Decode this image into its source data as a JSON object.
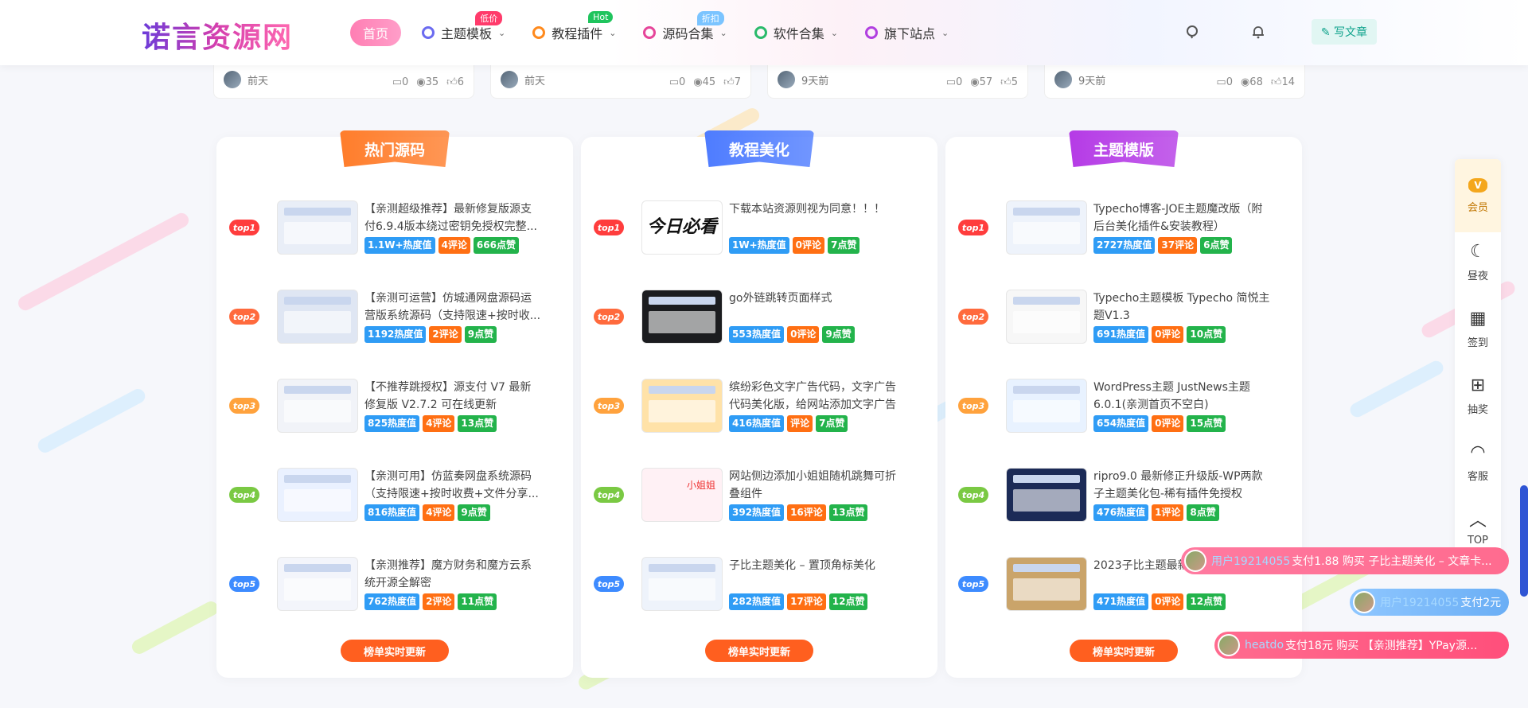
{
  "header": {
    "logo": "诺言资源网",
    "nav": [
      {
        "label": "首页",
        "active": true,
        "badge": "",
        "has_chevron": false
      },
      {
        "label": "主题模板",
        "active": false,
        "badge": "低价",
        "badge_color": "#ff3b6b",
        "icon_color": "#6b6bf0",
        "has_chevron": true
      },
      {
        "label": "教程插件",
        "active": false,
        "badge": "Hot",
        "badge_color": "#1fc45d",
        "icon_color": "#ff8a1d",
        "has_chevron": true
      },
      {
        "label": "源码合集",
        "active": false,
        "badge": "折扣",
        "badge_color": "#7bc4ff",
        "icon_color": "#e6459a",
        "has_chevron": true
      },
      {
        "label": "软件合集",
        "active": false,
        "badge": "",
        "icon_color": "#2aba6b",
        "has_chevron": true
      },
      {
        "label": "旗下站点",
        "active": false,
        "badge": "",
        "icon_color": "#b13fe0",
        "has_chevron": true
      }
    ],
    "write_label": "写文章"
  },
  "top_cards": [
    {
      "time": "前天",
      "comments": "0",
      "views": "35",
      "likes": "6"
    },
    {
      "time": "前天",
      "comments": "0",
      "views": "45",
      "likes": "7"
    },
    {
      "time": "9天前",
      "comments": "0",
      "views": "57",
      "likes": "5"
    },
    {
      "time": "9天前",
      "comments": "0",
      "views": "68",
      "likes": "14"
    }
  ],
  "panels": [
    {
      "title": "热门源码",
      "ribbon_color": "#ff7d2b",
      "update_label": "榜单实时更新",
      "items": [
        {
          "rank": "top1",
          "title": "【亲测超级推荐】最新修复版源支付6.9.4版本绕过密钥免授权完整...",
          "heat": "1.1W+热度值",
          "comments": "4评论",
          "likes": "666点赞"
        },
        {
          "rank": "top2",
          "title": "【亲测可运营】仿城通网盘源码运营版系统源码（支持限速+按时收...",
          "heat": "1192热度值",
          "comments": "2评论",
          "likes": "9点赞"
        },
        {
          "rank": "top3",
          "title": "【不推荐跳授权】源支付 V7 最新修复版 V2.7.2 可在线更新",
          "heat": "825热度值",
          "comments": "4评论",
          "likes": "13点赞"
        },
        {
          "rank": "top4",
          "title": "【亲测可用】仿蓝奏网盘系统源码（支持限速+按时收费+文件分享...",
          "heat": "816热度值",
          "comments": "4评论",
          "likes": "9点赞"
        },
        {
          "rank": "top5",
          "title": "【亲测推荐】魔方财务和魔方云系统开源全解密",
          "heat": "762热度值",
          "comments": "2评论",
          "likes": "11点赞"
        }
      ]
    },
    {
      "title": "教程美化",
      "ribbon_color": "#4e7cff",
      "update_label": "榜单实时更新",
      "items": [
        {
          "rank": "top1",
          "title": "下载本站资源则视为同意！！！",
          "heat": "1W+热度值",
          "comments": "0评论",
          "likes": "7点赞",
          "thumb_text": "今日必看"
        },
        {
          "rank": "top2",
          "title": "go外链跳转页面样式",
          "heat": "553热度值",
          "comments": "0评论",
          "likes": "9点赞"
        },
        {
          "rank": "top3",
          "title": "缤纷彩色文字广告代码，文字广告代码美化版，给网站添加文字广告",
          "heat": "416热度值",
          "comments": "评论",
          "likes": "7点赞"
        },
        {
          "rank": "top4",
          "title": "网站侧边添加小姐姐随机跳舞可折叠组件",
          "heat": "392热度值",
          "comments": "16评论",
          "likes": "13点赞",
          "thumb_text": "小姐姐"
        },
        {
          "rank": "top5",
          "title": "子比主题美化 – 置顶角标美化",
          "heat": "282热度值",
          "comments": "17评论",
          "likes": "12点赞"
        }
      ]
    },
    {
      "title": "主题模版",
      "ribbon_color": "#b53be6",
      "update_label": "榜单实时更新",
      "items": [
        {
          "rank": "top1",
          "title": "Typecho博客-JOE主题魔改版（附后台美化插件&安装教程）",
          "heat": "2727热度值",
          "comments": "37评论",
          "likes": "6点赞"
        },
        {
          "rank": "top2",
          "title": "Typecho主题模板 Typecho 简悦主题V1.3",
          "heat": "691热度值",
          "comments": "0评论",
          "likes": "10点赞"
        },
        {
          "rank": "top3",
          "title": "WordPress主题 JustNews主题6.0.1(亲测首页不空白)",
          "heat": "654热度值",
          "comments": "0评论",
          "likes": "15点赞"
        },
        {
          "rank": "top4",
          "title": "ripro9.0 最新修正升级版-WP两款子主题美化包-稀有插件免授权",
          "heat": "476热度值",
          "comments": "1评论",
          "likes": "8点赞"
        },
        {
          "rank": "top5",
          "title": "2023子比主题最新7.1版本源码",
          "heat": "471热度值",
          "comments": "0评论",
          "likes": "12点赞"
        }
      ]
    }
  ],
  "rank_colors": {
    "top1": "#ff3d3d",
    "top2": "#ff6a3d",
    "top3": "#ffa23d",
    "top4": "#7ac943",
    "top5": "#3d8bff"
  },
  "float_bar": [
    {
      "label": "会员",
      "icon": "vip-icon"
    },
    {
      "label": "昼夜",
      "icon": "moon-icon"
    },
    {
      "label": "签到",
      "icon": "calendar-icon"
    },
    {
      "label": "抽奖",
      "icon": "gift-icon"
    },
    {
      "label": "客服",
      "icon": "headset-icon"
    },
    {
      "label": "TOP",
      "icon": "arrow-up-icon"
    }
  ],
  "notices": [
    {
      "user": "用户19214055",
      "text": "支付1.88 购买 子比主题美化 – 文章卡..."
    },
    {
      "user": "用户19214055",
      "text": "支付2元"
    },
    {
      "user": "heatdo",
      "text": "支付18元 购买 【亲测推荐】YPay源..."
    }
  ]
}
